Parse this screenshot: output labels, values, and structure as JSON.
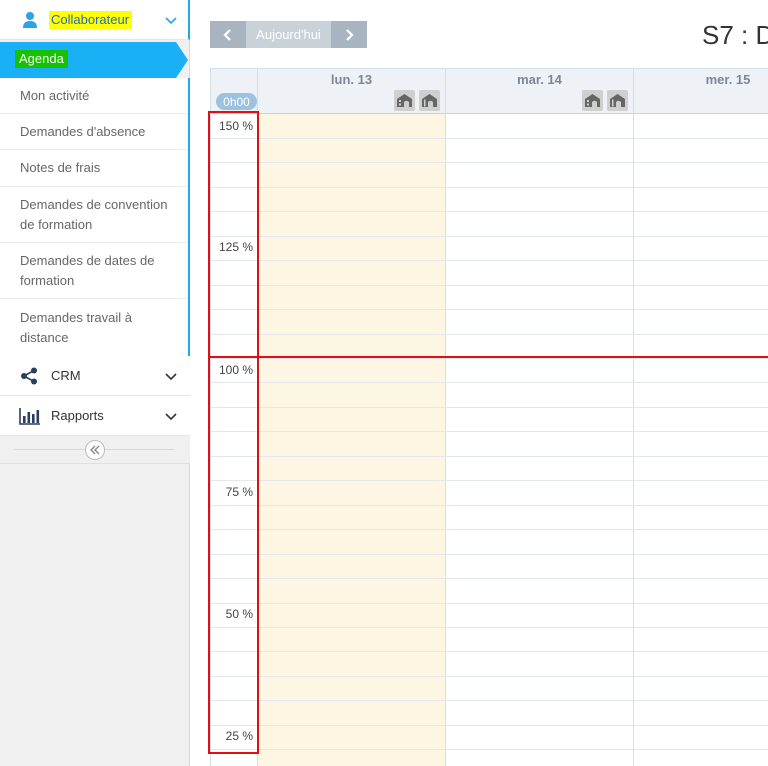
{
  "sidebar": {
    "collaborateur": {
      "label": "Collaborateur",
      "icon": "user-icon"
    },
    "active_item": "Agenda",
    "items": [
      "Mon activité",
      "Demandes d'absence",
      "Notes de frais",
      "Demandes de convention de formation",
      "Demandes de dates de formation",
      "Demandes travail à distance"
    ],
    "crm": {
      "label": "CRM",
      "icon": "share-icon"
    },
    "rapports": {
      "label": "Rapports",
      "icon": "bar-chart-icon"
    }
  },
  "toolbar": {
    "today_label": "Aujourd'hui",
    "week_title": "S7 : D"
  },
  "calendar": {
    "time_badge": "0h00",
    "days": [
      {
        "label": "lun. 13"
      },
      {
        "label": "mar. 14"
      },
      {
        "label": "mer. 15"
      }
    ],
    "percent_labels": [
      "150 %",
      "125 %",
      "100 %",
      "75 %",
      "50 %",
      "25 %"
    ]
  },
  "colors": {
    "accent": "#1ab0f5",
    "highlight_yellow": "#ffff00",
    "highlight_green": "#17c000",
    "annotation_red": "#dd1111",
    "today_column": "#fcf6e2"
  }
}
